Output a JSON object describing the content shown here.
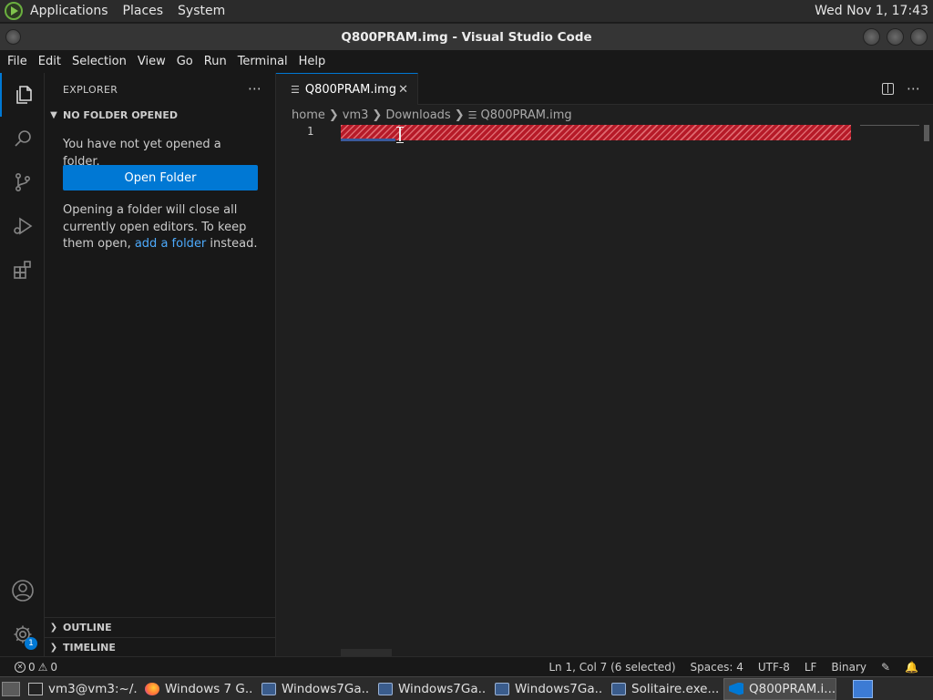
{
  "top_panel": {
    "menus": [
      "Applications",
      "Places",
      "System"
    ],
    "clock": "Wed Nov 1, 17:43"
  },
  "window": {
    "title": "Q800PRAM.img - Visual Studio Code"
  },
  "menubar": [
    "File",
    "Edit",
    "Selection",
    "View",
    "Go",
    "Run",
    "Terminal",
    "Help"
  ],
  "activity_bar": {
    "icons": [
      "explorer-icon",
      "search-icon",
      "source-control-icon",
      "run-debug-icon",
      "extensions-icon",
      "accounts-icon",
      "manage-gear-icon"
    ],
    "manage_badge": "1"
  },
  "sidebar": {
    "title": "EXPLORER",
    "more": "⋯",
    "section_title": "NO FOLDER OPENED",
    "message": "You have not yet opened a folder.",
    "open_folder_label": "Open Folder",
    "note_prefix": "Opening a folder will close all currently open editors. To keep them open, ",
    "note_link": "add a folder",
    "note_suffix": " instead.",
    "outline_label": "OUTLINE",
    "timeline_label": "TIMELINE"
  },
  "editor": {
    "tab_label": "Q800PRAM.img",
    "breadcrumb": [
      "home",
      "vm3",
      "Downloads",
      "Q800PRAM.img"
    ],
    "line_number": "1"
  },
  "statusbar": {
    "errors": "0",
    "warnings": "0",
    "position": "Ln 1, Col 7 (6 selected)",
    "indent": "Spaces: 4",
    "encoding": "UTF-8",
    "eol": "LF",
    "language": "Binary"
  },
  "taskbar": {
    "tasks": [
      "vm3@vm3:~/...",
      "Windows 7 G...",
      "Windows7Ga...",
      "Windows7Ga...",
      "Windows7Ga...",
      "Solitaire.exe...",
      "Q800PRAM.i..."
    ]
  },
  "colors": {
    "accent": "#0078d4",
    "binary_highlight": "#b61a28",
    "link": "#4daafc"
  }
}
